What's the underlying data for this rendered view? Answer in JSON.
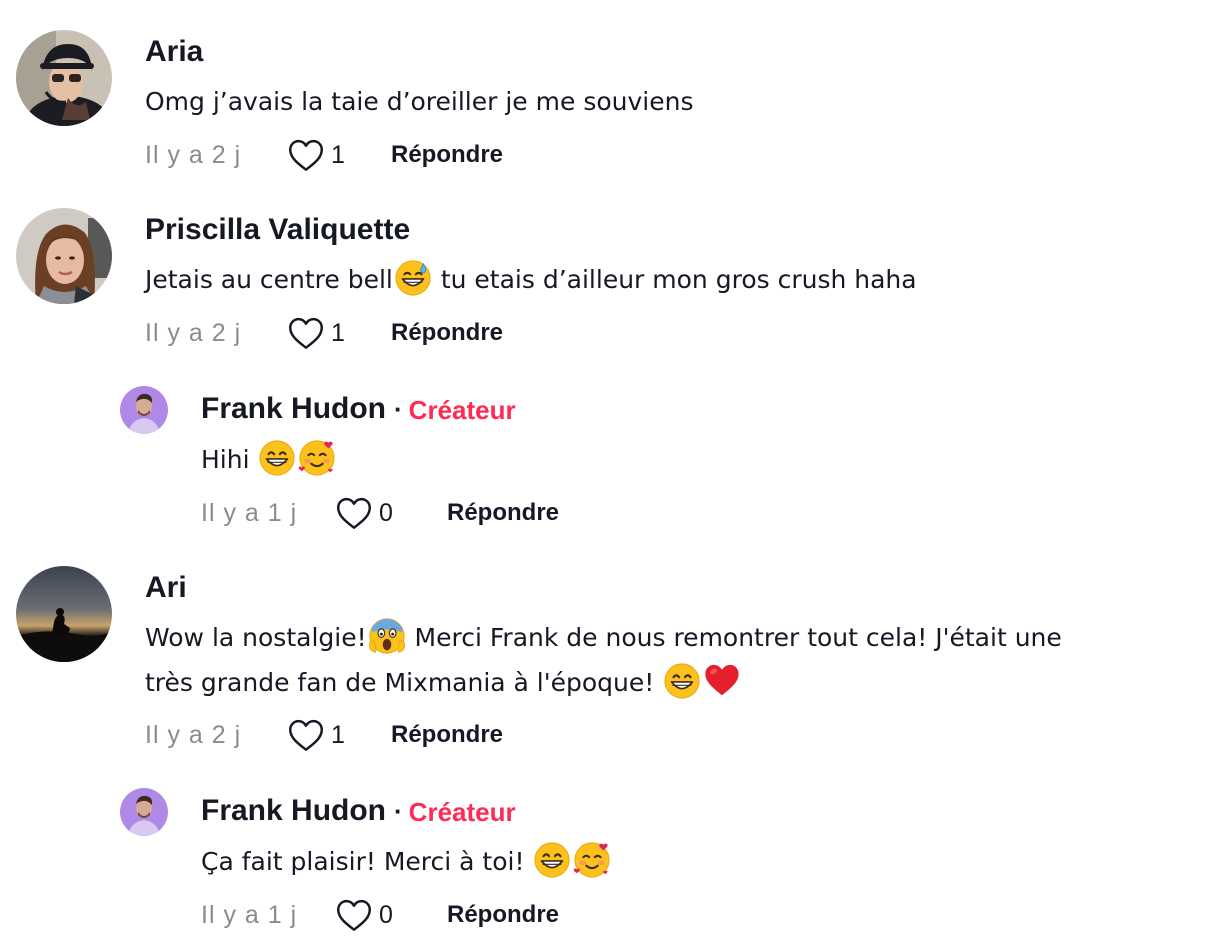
{
  "comments": [
    {
      "author": "Aria",
      "text": "Omg j’avais la taie d’oreiller je me souviens",
      "time": "Il y a 2 j",
      "likes": "1",
      "reply_label": "Répondre"
    },
    {
      "author": "Priscilla Valiquette",
      "text_before": "Jetais au centre bell",
      "text_after": " tu etais d’ailleur mon gros crush haha",
      "emoji": "grinning-sweat-emoji",
      "time": "Il y a 2 j",
      "likes": "1",
      "reply_label": "Répondre",
      "reply": {
        "author": "Frank Hudon",
        "badge_separator": "·",
        "badge": "Créateur",
        "text": "Hihi ",
        "emojis": [
          "beaming-face-emoji",
          "smiling-hearts-emoji"
        ],
        "time": "Il y a 1 j",
        "likes": "0",
        "reply_label": "Répondre"
      }
    },
    {
      "author": "Ari",
      "line1_before": "Wow la nostalgie!",
      "line1_after": " Merci Frank de nous remontrer tout cela! J'était une",
      "line2": "très grande fan de Mixmania à l'époque! ",
      "emojis": [
        "screaming-face-emoji",
        "beaming-face-emoji",
        "red-heart-emoji"
      ],
      "time": "Il y a 2 j",
      "likes": "1",
      "reply_label": "Répondre",
      "reply": {
        "author": "Frank Hudon",
        "badge_separator": "·",
        "badge": "Créateur",
        "text": "Ça fait plaisir! Merci à toi! ",
        "emojis": [
          "beaming-face-emoji",
          "smiling-hearts-emoji"
        ],
        "time": "Il y a 1 j",
        "likes": "0",
        "reply_label": "Répondre"
      }
    }
  ],
  "colors": {
    "text": "#161823",
    "muted": "#8a8b91",
    "creator": "#fe2c55"
  }
}
